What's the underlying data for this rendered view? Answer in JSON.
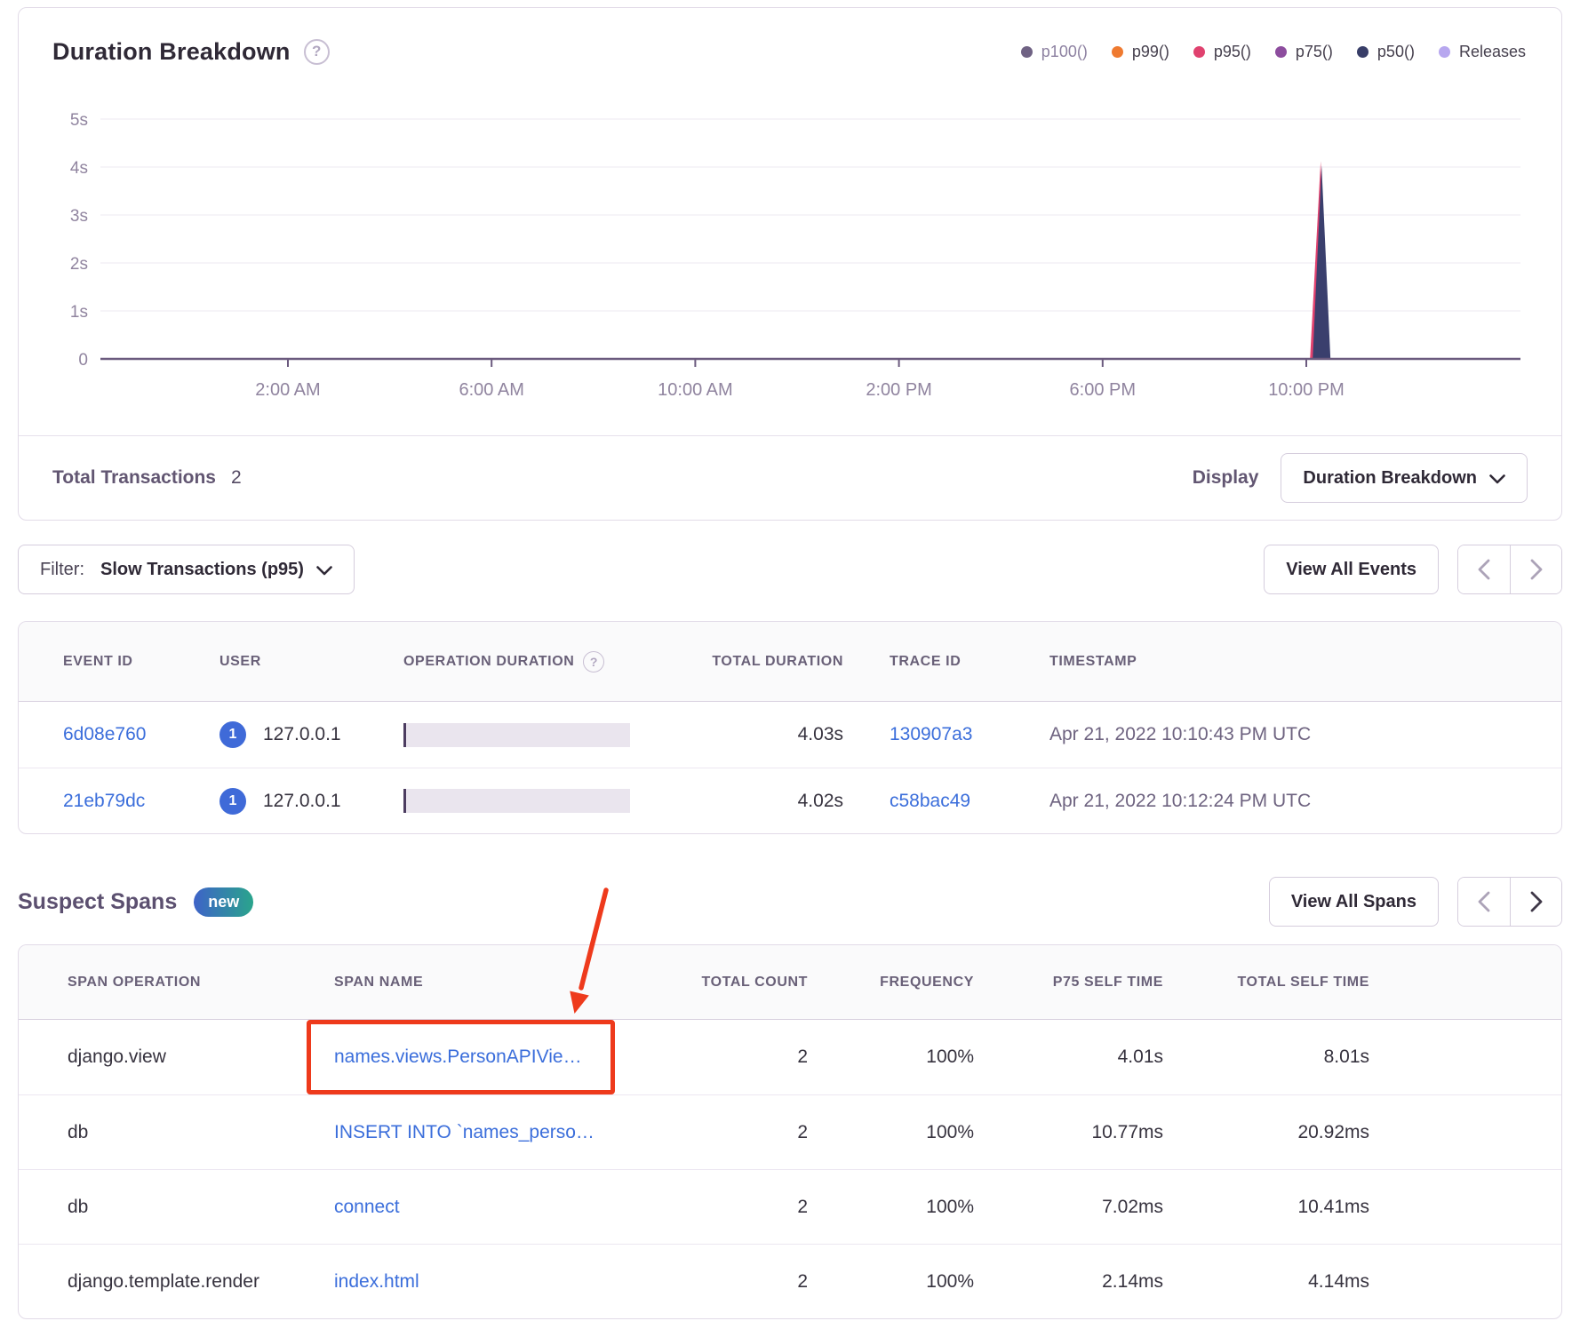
{
  "chart": {
    "title": "Duration Breakdown",
    "help_glyph": "?",
    "legend": [
      {
        "label": "p100()",
        "color": "#6f6284",
        "muted": true
      },
      {
        "label": "p99()",
        "color": "#ef7a30",
        "muted": false
      },
      {
        "label": "p95()",
        "color": "#e0426f",
        "muted": false
      },
      {
        "label": "p75()",
        "color": "#8d4d9e",
        "muted": false
      },
      {
        "label": "p50()",
        "color": "#383e68",
        "muted": false
      },
      {
        "label": "Releases",
        "color": "#b7a7ef",
        "muted": false
      }
    ]
  },
  "chart_data": {
    "type": "area",
    "title": "Duration Breakdown",
    "x_labels": [
      "2:00 AM",
      "6:00 AM",
      "10:00 AM",
      "2:00 PM",
      "6:00 PM",
      "10:00 PM"
    ],
    "x_label_hours": [
      2,
      6,
      10,
      14,
      18,
      22
    ],
    "y_tick_labels": [
      "0",
      "1s",
      "2s",
      "3s",
      "4s",
      "5s"
    ],
    "y_tick_seconds": [
      0,
      1,
      2,
      3,
      4,
      5
    ],
    "ylim": [
      0,
      5
    ],
    "grid": true,
    "legend_position": "top-right",
    "axis_color": "#6b5a7e",
    "grid_color": "#f6f4f8",
    "tick_label_color": "#90849f",
    "spike": {
      "hour": 22.3,
      "peak_seconds": 4.03,
      "fill_color": "#3a3f6d",
      "outline_color": "#e0426f",
      "note": "single narrow spike near 10:00 PM, all other values 0"
    }
  },
  "summary": {
    "total_transactions_label": "Total Transactions",
    "total_transactions_value": "2",
    "display_label": "Display",
    "display_value": "Duration Breakdown"
  },
  "toolbar": {
    "filter_label": "Filter:",
    "filter_value": "Slow Transactions (p95)",
    "view_all_events_label": "View All Events"
  },
  "events_table": {
    "headers": [
      {
        "label": "EVENT ID"
      },
      {
        "label": "USER"
      },
      {
        "label": "OPERATION DURATION",
        "help": true
      },
      {
        "label": "TOTAL DURATION",
        "align": "right"
      },
      {
        "label": "TRACE ID",
        "pad": true
      },
      {
        "label": "TIMESTAMP"
      }
    ],
    "rows": [
      {
        "event_id": "6d08e760",
        "user_count": "1",
        "user_ip": "127.0.0.1",
        "total_duration": "4.03s",
        "trace_id": "130907a3",
        "timestamp": "Apr 21, 2022 10:10:43 PM UTC"
      },
      {
        "event_id": "21eb79dc",
        "user_count": "1",
        "user_ip": "127.0.0.1",
        "total_duration": "4.02s",
        "trace_id": "c58bac49",
        "timestamp": "Apr 21, 2022 10:12:24 PM UTC"
      }
    ]
  },
  "suspect_spans": {
    "title": "Suspect Spans",
    "badge": "new",
    "view_all_spans_label": "View All Spans"
  },
  "spans_table": {
    "headers": [
      {
        "label": "SPAN OPERATION"
      },
      {
        "label": "SPAN NAME"
      },
      {
        "label": "TOTAL COUNT",
        "align": "right"
      },
      {
        "label": "FREQUENCY",
        "align": "right"
      },
      {
        "label": "P75 SELF TIME",
        "align": "right"
      },
      {
        "label": "TOTAL SELF TIME",
        "align": "right"
      }
    ],
    "rows": [
      {
        "operation": "django.view",
        "name": "names.views.PersonAPIVie…",
        "count": "2",
        "frequency": "100%",
        "p75": "4.01s",
        "total": "8.01s"
      },
      {
        "operation": "db",
        "name": "INSERT INTO `names_perso…",
        "count": "2",
        "frequency": "100%",
        "p75": "10.77ms",
        "total": "20.92ms"
      },
      {
        "operation": "db",
        "name": "connect",
        "count": "2",
        "frequency": "100%",
        "p75": "7.02ms",
        "total": "10.41ms"
      },
      {
        "operation": "django.template.render",
        "name": "index.html",
        "count": "2",
        "frequency": "100%",
        "p75": "2.14ms",
        "total": "4.14ms"
      }
    ]
  },
  "annotation": {
    "color": "#ee3a1c"
  },
  "colors": {
    "link": "#3b6edb",
    "muted_legend_text": "#8d81a1",
    "legend_text": "#46404e",
    "pager_chevron_light": "#aca3b8",
    "pager_chevron_dark": "#3f3848"
  }
}
